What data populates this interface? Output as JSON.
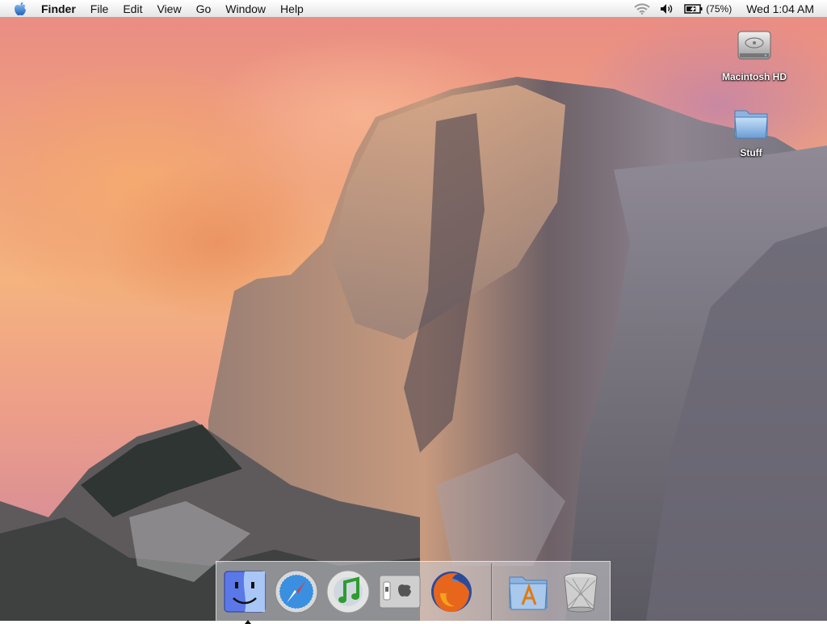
{
  "menubar": {
    "apple_menu": "apple-icon",
    "items": [
      {
        "label": "Finder"
      },
      {
        "label": "File"
      },
      {
        "label": "Edit"
      },
      {
        "label": "View"
      },
      {
        "label": "Go"
      },
      {
        "label": "Window"
      },
      {
        "label": "Help"
      }
    ],
    "status": {
      "wifi": "wifi-icon",
      "volume": "volume-icon",
      "battery_icon": "battery-charging-icon",
      "battery_percent": "(75%)",
      "battery_level": 0.75,
      "clock": "Wed 1:04 AM"
    }
  },
  "desktop": {
    "icons": [
      {
        "label": "Macintosh HD",
        "icon": "hard-drive-icon"
      },
      {
        "label": "Stuff",
        "icon": "folder-icon"
      }
    ]
  },
  "dock": {
    "apps": [
      {
        "name": "Finder",
        "icon": "finder-icon",
        "running": true
      },
      {
        "name": "Safari",
        "icon": "safari-icon",
        "running": false
      },
      {
        "name": "iTunes",
        "icon": "itunes-icon",
        "running": false
      },
      {
        "name": "System Preferences",
        "icon": "system-preferences-icon",
        "running": false
      },
      {
        "name": "Firefox",
        "icon": "firefox-icon",
        "running": false
      }
    ],
    "others": [
      {
        "name": "Applications",
        "icon": "applications-folder-icon"
      },
      {
        "name": "Trash",
        "icon": "trash-icon"
      }
    ]
  },
  "colors": {
    "sky_top": "#e98a84",
    "sky_mid": "#f4b37f",
    "rock": "#8a7d78",
    "menubar": "#f2f2f2"
  }
}
